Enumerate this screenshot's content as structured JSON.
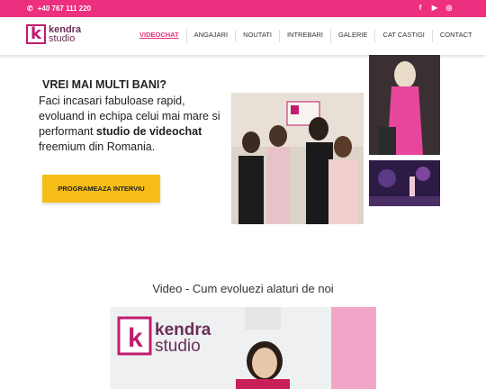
{
  "topbar": {
    "phone": "+40 767 111 220"
  },
  "logo": {
    "mark": "k",
    "word1": "kendra",
    "word2": "studio"
  },
  "nav": {
    "items": [
      "VIDEOCHAT",
      "ANGAJARI",
      "NOUTATI",
      "INTREBARI",
      "GALERIE",
      "CAT CASTIGI",
      "CONTACT"
    ]
  },
  "hero": {
    "title": "VREI MAI MULTI BANI?",
    "line1": "Faci incasari fabuloase rapid, evoluand in echipa celui mai mare si performant ",
    "bold": "studio de videochat",
    "line2": " freemium din Romania.",
    "cta": "PROGRAMEAZA INTERVIU"
  },
  "video": {
    "title": "Video - Cum evoluezi alaturi de noi",
    "logo_word1": "kendra",
    "logo_word2": "studio"
  },
  "colors": {
    "accent": "#ec2f7e",
    "cta": "#f6bd16"
  }
}
